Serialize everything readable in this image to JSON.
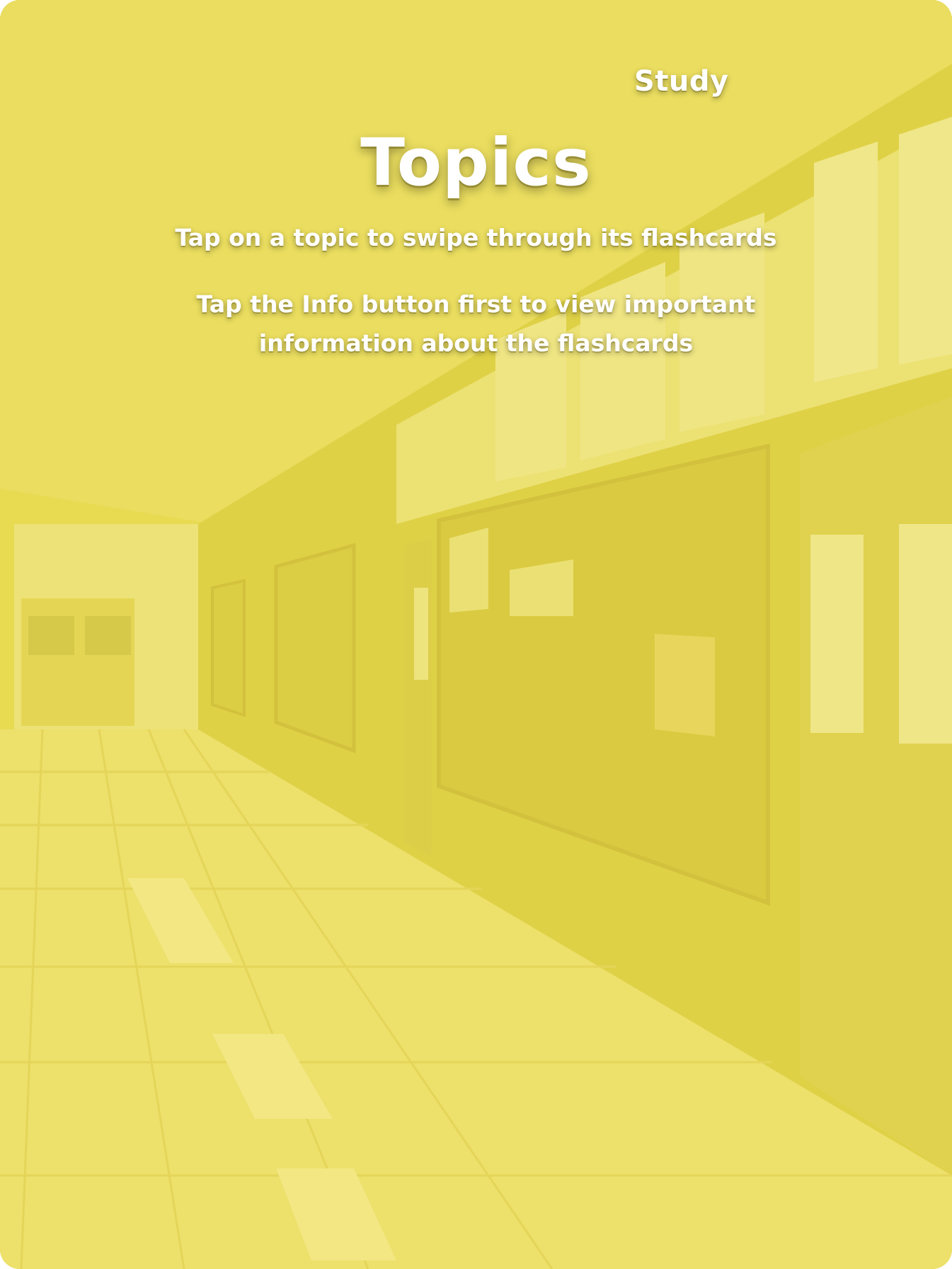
{
  "header": {
    "nav_study": "Study"
  },
  "main": {
    "title": "Topics",
    "subtitle": "Tap on a topic to swipe through its flashcards",
    "info_line_1": "Tap the Info button first to view important",
    "info_line_2": "information about the flashcards"
  },
  "colors": {
    "overlay_yellow": "#e6d94f",
    "text": "#ffffff"
  },
  "background": {
    "scene": "school-hallway-illustration"
  }
}
